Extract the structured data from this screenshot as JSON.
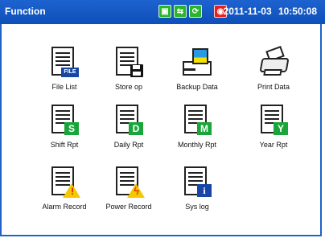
{
  "header": {
    "title": "Function",
    "datetime": "2011-11-03  10:50:08",
    "status_icons": [
      "usb-green-icon",
      "usb-connect-icon",
      "sync-icon",
      "sound-icon"
    ]
  },
  "menu": {
    "items": [
      {
        "label": "File List",
        "icon": "file-list-icon"
      },
      {
        "label": "Store op",
        "icon": "store-op-icon"
      },
      {
        "label": "Backup Data",
        "icon": "backup-data-icon"
      },
      {
        "label": "Print Data",
        "icon": "print-data-icon"
      },
      {
        "label": "Shift Rpt",
        "icon": "shift-rpt-icon",
        "badge": "S"
      },
      {
        "label": "Daily Rpt",
        "icon": "daily-rpt-icon",
        "badge": "D"
      },
      {
        "label": "Monthly Rpt",
        "icon": "monthly-rpt-icon",
        "badge": "M"
      },
      {
        "label": "Year Rpt",
        "icon": "year-rpt-icon",
        "badge": "Y"
      },
      {
        "label": "Alarm Record",
        "icon": "alarm-record-icon"
      },
      {
        "label": "Power Record",
        "icon": "power-record-icon"
      },
      {
        "label": "Sys log",
        "icon": "sys-log-icon"
      }
    ],
    "file_badge": "FILE",
    "info_badge": "i"
  },
  "colors": {
    "titlebar": "#1d63cf",
    "badge_green": "#1aa53a",
    "badge_blue": "#1746a6",
    "warning_yellow": "#f5c800"
  }
}
